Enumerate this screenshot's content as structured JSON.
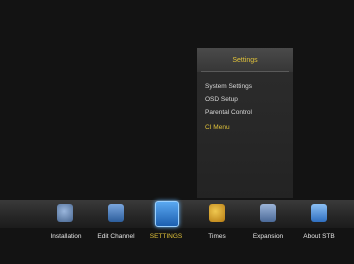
{
  "popup": {
    "title": "Settings",
    "items": [
      {
        "label": "System Settings"
      },
      {
        "label": "OSD Setup"
      },
      {
        "label": "Parental Control"
      },
      {
        "label": "CI Menu"
      }
    ],
    "selected_index": 3
  },
  "bottom_menu": {
    "items": [
      {
        "label": "Installation",
        "icon": "satellite-dish-icon",
        "color": "#5b7fb0"
      },
      {
        "label": "Edit Channel",
        "icon": "tv-edit-icon",
        "color": "#4f86c6"
      },
      {
        "label": "SETTINGS",
        "icon": "settings-icon",
        "color": "#2f7fd0"
      },
      {
        "label": "Times",
        "icon": "clock-icon",
        "color": "#d8a028"
      },
      {
        "label": "Expansion",
        "icon": "expansion-icon",
        "color": "#6a8cc0"
      },
      {
        "label": "About STB",
        "icon": "info-icon",
        "color": "#4b8bd6"
      }
    ],
    "selected_index": 2
  },
  "colors": {
    "highlight": "#e0c23a",
    "text": "#e6e6e6"
  }
}
